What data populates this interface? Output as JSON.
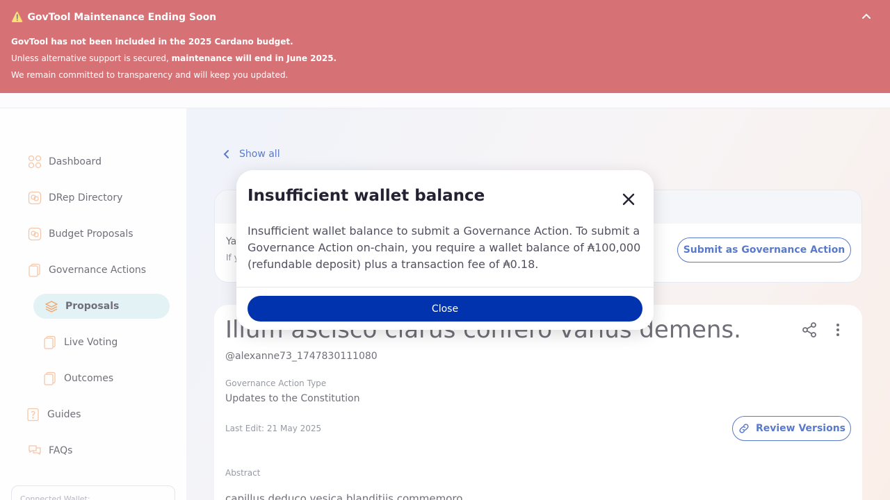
{
  "banner": {
    "warning_glyph": "⚠️",
    "title": "GovTool Maintenance Ending Soon",
    "line1": "GovTool has not been included in the 2025 Cardano budget.",
    "line2_prefix": "Unless alternative support is secured, ",
    "line2_bold": "maintenance will end in June 2025.",
    "line3": "We remain committed to transparency and will keep you updated.",
    "collapse_icon": "chevron-up-icon"
  },
  "sidebar": {
    "items": [
      {
        "label": "Dashboard",
        "icon": "dashboard-icon"
      },
      {
        "label": "DRep Directory",
        "icon": "drep-icon"
      },
      {
        "label": "Budget Proposals",
        "icon": "budget-icon"
      },
      {
        "label": "Governance Actions",
        "icon": "governance-icon"
      },
      {
        "label": "Proposals",
        "icon": "proposals-icon",
        "active": true
      },
      {
        "label": "Live Voting",
        "icon": "live-voting-icon"
      },
      {
        "label": "Outcomes",
        "icon": "outcomes-icon"
      },
      {
        "label": "Guides",
        "icon": "guides-icon"
      },
      {
        "label": "FAQs",
        "icon": "faqs-icon"
      }
    ],
    "wallet_label": "Connected Wallet:"
  },
  "main": {
    "show_all": "Show all",
    "info_card": {
      "line1": "Ya",
      "line2": "If y",
      "submit_label": "Submit as Governance Action"
    },
    "detail": {
      "title": "Illum ascisco clarus confero varius demens.",
      "username": "@alexanne73_1747830111080",
      "type_label": "Governance Action Type",
      "type_value": "Updates to the Constitution",
      "last_edit": "Last Edit: 21 May 2025",
      "review_versions": "Review Versions",
      "abstract_label": "Abstract",
      "abstract_text": "capillus deduco vesica blanditiis commemoro"
    }
  },
  "modal": {
    "title": "Insufficient wallet balance",
    "body": "Insufficient wallet balance to submit a Governance Action. To submit a Governance Action on-chain, you require a wallet balance of ₳100,000 (refundable deposit) plus a transaction fee of ₳0.18.",
    "close_label": "Close"
  },
  "colors": {
    "banner": "#c0262b",
    "primary": "#0033ad",
    "active_nav": "#d4ecf0"
  }
}
